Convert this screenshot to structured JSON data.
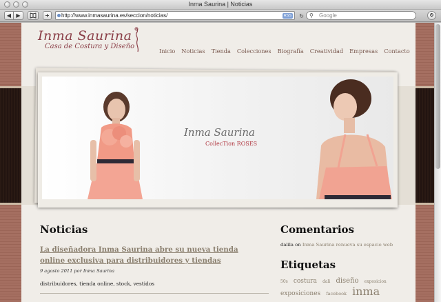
{
  "window": {
    "title": "Inma Saurina | Noticias"
  },
  "toolbar": {
    "back": "◀",
    "forward": "▶",
    "add": "+",
    "url": "http://www.inmasaurina.es/seccion/noticias/",
    "rss": "RSS",
    "search_placeholder": "Google"
  },
  "site": {
    "logo_name": "Inma Saurina",
    "logo_subtitle": "Casa de Costura y Diseño",
    "nav": [
      "Inicio",
      "Noticias",
      "Tienda",
      "Colecciones",
      "Biografía",
      "Creatividad",
      "Empresas",
      "Contacto"
    ]
  },
  "banner": {
    "title": "Inma Saurina",
    "collection": "CollecTion ROSES"
  },
  "news": {
    "heading": "Noticias",
    "post": {
      "title": "La diseñadora Inma Saurina abre su nueva tienda online exclusiva para distribuidores y tiendas",
      "meta": "9 agosto 2011 por Inma Saurina",
      "tags": "distribuidores, tienda online, stock, vestidos"
    }
  },
  "sidebar": {
    "comments_heading": "Comentarios",
    "comment_author": "dalila",
    "comment_on": "on",
    "comment_link": "Inma Saurina renueva su espacio web",
    "tags_heading": "Etiquetas",
    "tags": [
      {
        "label": "50s",
        "size": 6
      },
      {
        "label": "costura",
        "size": 9
      },
      {
        "label": "dali",
        "size": 6
      },
      {
        "label": "diseño",
        "size": 10
      },
      {
        "label": "exposicion",
        "size": 6
      },
      {
        "label": "exposiciones",
        "size": 9
      },
      {
        "label": "facebook",
        "size": 6.5
      },
      {
        "label": "inma",
        "size": 16
      }
    ]
  },
  "colors": {
    "accent": "#8a3e47",
    "link": "#8a7f6e",
    "background": "#f0ede8",
    "frame": "#a06a5c"
  }
}
